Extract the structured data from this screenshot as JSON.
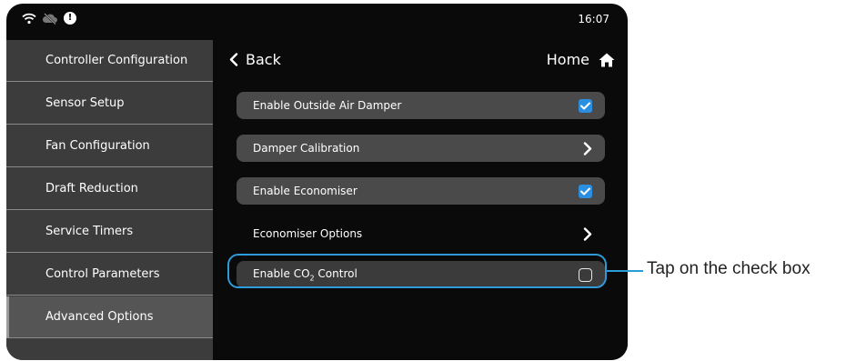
{
  "status": {
    "time": "16:07",
    "alert": "!"
  },
  "sidebar": {
    "items": [
      {
        "label": "Controller Configuration"
      },
      {
        "label": "Sensor Setup"
      },
      {
        "label": "Fan Configuration"
      },
      {
        "label": "Draft Reduction"
      },
      {
        "label": "Service Timers"
      },
      {
        "label": "Control Parameters"
      },
      {
        "label": "Advanced Options",
        "active": true
      }
    ]
  },
  "header": {
    "back_label": "Back",
    "home_label": "Home"
  },
  "settings": [
    {
      "label": "Enable Outside Air Damper",
      "control": "checkbox",
      "checked": true
    },
    {
      "label": "Damper Calibration",
      "control": "chevron"
    },
    {
      "label": "Enable Economiser",
      "control": "checkbox",
      "checked": true
    },
    {
      "label": "Economiser Options",
      "control": "chevron"
    },
    {
      "label_prefix": "Enable CO",
      "label_sub": "2",
      "label_suffix": " Control",
      "control": "checkbox",
      "checked": false
    }
  ],
  "callout": {
    "text": "Tap on the check box"
  },
  "colors": {
    "accent": "#2d9ad9",
    "checkbox": "#2a8fe0",
    "sidebar": "#3c3c3c",
    "row": "#4a4a4a"
  }
}
